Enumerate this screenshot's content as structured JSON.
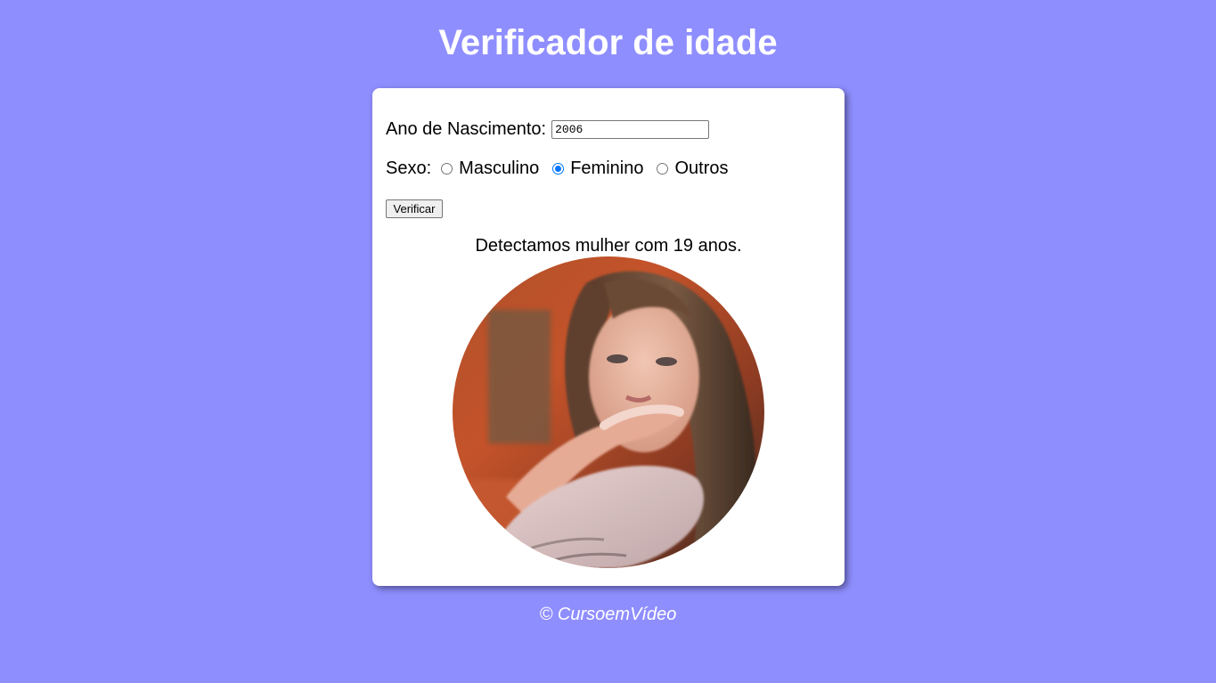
{
  "header": {
    "title": "Verificador de idade"
  },
  "form": {
    "year_label": "Ano de Nascimento:",
    "year_value": "2006",
    "sex_label": "Sexo:",
    "sex_options": [
      {
        "label": "Masculino",
        "checked": false
      },
      {
        "label": "Feminino",
        "checked": true
      },
      {
        "label": "Outros",
        "checked": false
      }
    ],
    "verify_label": "Verificar"
  },
  "result": {
    "text": "Detectamos mulher com 19 anos.",
    "photo_icon": "woman-photo"
  },
  "footer": {
    "text": "© CursoemVídeo"
  },
  "colors": {
    "background": "#8f8eff",
    "card": "#ffffff",
    "accent": "#0075ff"
  }
}
